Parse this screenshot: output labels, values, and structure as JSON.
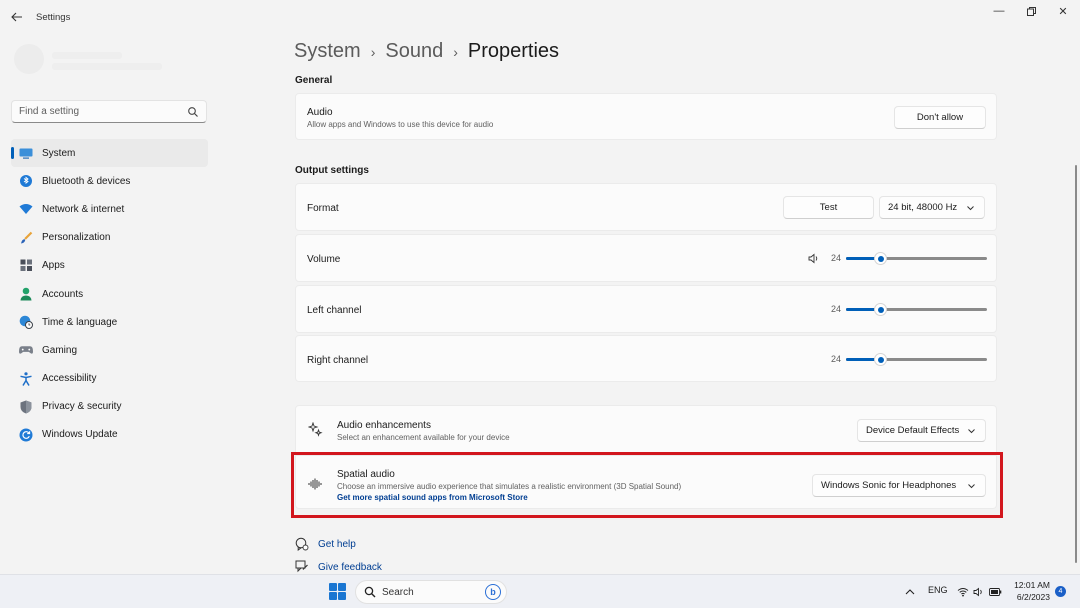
{
  "window": {
    "title": "Settings",
    "controls": {
      "minimize": "—",
      "maximize": "▢",
      "close": "✕"
    }
  },
  "sidebar": {
    "search_placeholder": "Find a setting",
    "items": [
      {
        "label": "System",
        "icon": "system-icon",
        "active": true
      },
      {
        "label": "Bluetooth & devices",
        "icon": "bluetooth-icon"
      },
      {
        "label": "Network & internet",
        "icon": "wifi-icon"
      },
      {
        "label": "Personalization",
        "icon": "brush-icon"
      },
      {
        "label": "Apps",
        "icon": "apps-icon"
      },
      {
        "label": "Accounts",
        "icon": "person-icon"
      },
      {
        "label": "Time & language",
        "icon": "globe-clock-icon"
      },
      {
        "label": "Gaming",
        "icon": "controller-icon"
      },
      {
        "label": "Accessibility",
        "icon": "accessibility-icon"
      },
      {
        "label": "Privacy & security",
        "icon": "shield-icon"
      },
      {
        "label": "Windows Update",
        "icon": "update-icon"
      }
    ]
  },
  "breadcrumb": {
    "level1": "System",
    "level2": "Sound",
    "current": "Properties",
    "separator": "›"
  },
  "general": {
    "heading": "General",
    "audio": {
      "title": "Audio",
      "subtitle": "Allow apps and Windows to use this device for audio",
      "button": "Don't allow"
    }
  },
  "output": {
    "heading": "Output settings",
    "format": {
      "title": "Format",
      "test_button": "Test",
      "value": "24 bit, 48000 Hz"
    },
    "volume": {
      "title": "Volume",
      "value": "24",
      "level": 0.24
    },
    "left": {
      "title": "Left channel",
      "value": "24",
      "level": 0.24
    },
    "right": {
      "title": "Right channel",
      "value": "24",
      "level": 0.24
    }
  },
  "enhancements": {
    "title": "Audio enhancements",
    "subtitle": "Select an enhancement available for your device",
    "value": "Device Default Effects"
  },
  "spatial": {
    "title": "Spatial audio",
    "subtitle": "Choose an immersive audio experience that simulates a realistic environment (3D Spatial Sound)",
    "link": "Get more spatial sound apps from Microsoft Store",
    "value": "Windows Sonic for Headphones"
  },
  "help": {
    "get_help": "Get help",
    "give_feedback": "Give feedback"
  },
  "taskbar": {
    "search_label": "Search",
    "language": "ENG",
    "time": "12:01 AM",
    "date": "6/2/2023",
    "notifications": "4"
  },
  "colors": {
    "accent": "#005fb8",
    "highlight": "#d2161d"
  }
}
